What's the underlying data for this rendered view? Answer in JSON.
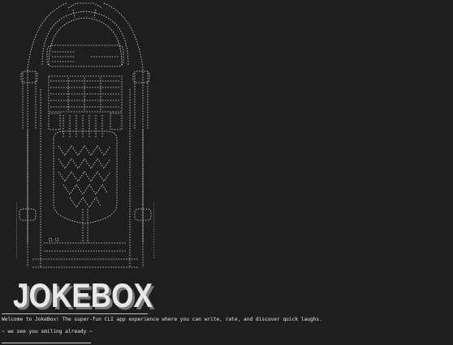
{
  "app": {
    "logo_text": "JOKEBOX"
  },
  "terminal": {
    "welcome_text": "Welcome to JokeBox! The super-fun CLI app experience where you can write, rate, and discover quick laughs.",
    "smiling_text": "~ we see you smiling already ~"
  },
  "colors": {
    "background": "#1e1e1e",
    "text": "#e6e6e6",
    "logo_light": "#e8e8e8",
    "logo_shadow": "#7a7a7a"
  }
}
